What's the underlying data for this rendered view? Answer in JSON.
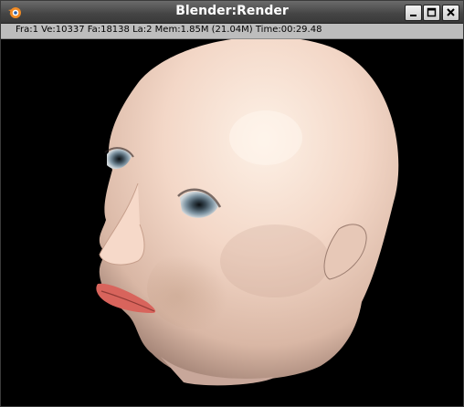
{
  "window": {
    "title": "Blender:Render",
    "icon": "blender-logo-icon",
    "controls": {
      "minimize_icon": "minimize-icon",
      "maximize_icon": "maximize-icon",
      "close_icon": "close-icon"
    }
  },
  "status": {
    "text": "Fra:1  Ve:10337 Fa:18138 La:2 Mem:1.85M (21.04M) Time:00:29.48"
  },
  "viewport": {
    "background": "#000000",
    "content": "rendered-head-model",
    "skin_color": "#f1d3c2",
    "lip_color": "#d8645c"
  }
}
